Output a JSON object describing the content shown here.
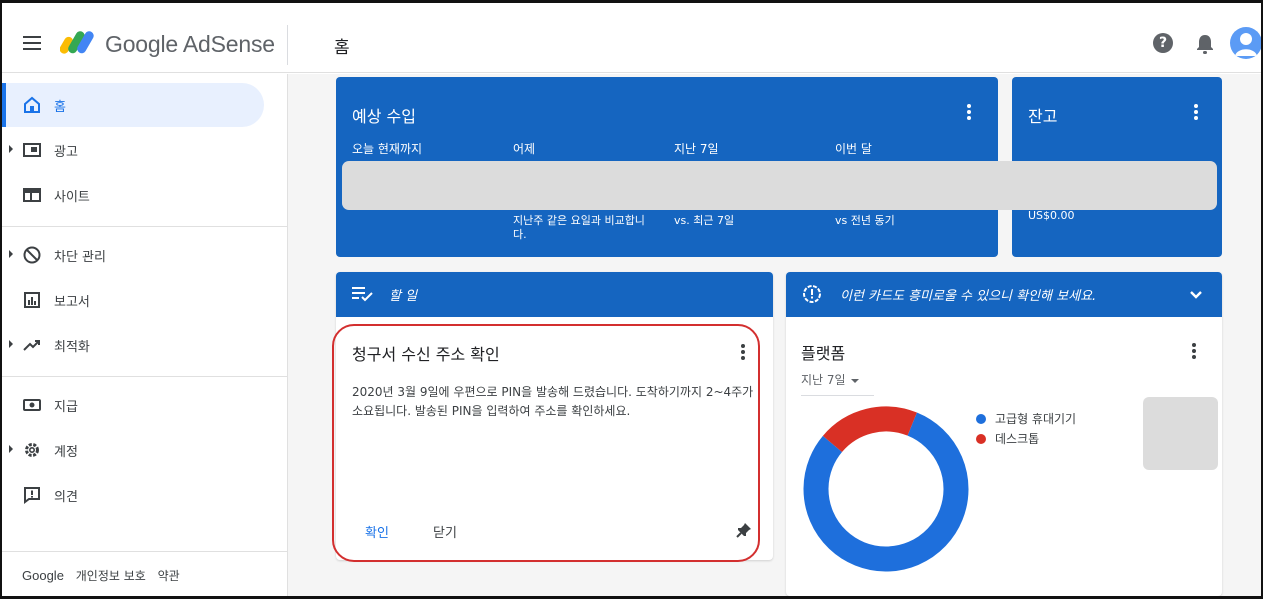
{
  "header": {
    "app_name": "Google AdSense",
    "page_title": "홈",
    "help_glyph": "?"
  },
  "sidebar": {
    "items": [
      {
        "label": "홈",
        "icon": "home-icon",
        "active": true
      },
      {
        "label": "광고",
        "icon": "ads-icon",
        "expandable": true
      },
      {
        "label": "사이트",
        "icon": "sites-icon"
      },
      {
        "label": "차단 관리",
        "icon": "block-icon",
        "expandable": true
      },
      {
        "label": "보고서",
        "icon": "reports-icon"
      },
      {
        "label": "최적화",
        "icon": "optimization-icon",
        "expandable": true
      },
      {
        "label": "지급",
        "icon": "payments-icon"
      },
      {
        "label": "계정",
        "icon": "gear-icon",
        "expandable": true
      },
      {
        "label": "의견",
        "icon": "feedback-icon"
      }
    ],
    "footer": {
      "brand": "Google",
      "privacy": "개인정보 보호",
      "terms": "약관"
    }
  },
  "earnings_card": {
    "title": "예상 수입",
    "columns": [
      "오늘 현재까지",
      "어제",
      "지난 7일",
      "이번 달"
    ],
    "sub": [
      "",
      "지난주 같은 요일과 비교합니다.",
      "vs. 최근 7일",
      "vs 전년 동기"
    ]
  },
  "balance_card": {
    "title": "잔고",
    "amount": "US$0.00"
  },
  "todo_card": {
    "header": "할 일",
    "title": "청구서 수신 주소 확인",
    "body": "2020년 3월 9일에 우편으로 PIN을 발송해 드렸습니다. 도착하기까지 2~4주가 소요됩니다. 발송된 PIN을 입력하여 주소를 확인하세요.",
    "confirm": "확인",
    "dismiss": "닫기"
  },
  "platform_card": {
    "header": "이런 카드도 흥미로울 수 있으니 확인해 보세요.",
    "title": "플랫폼",
    "period": "지난 7일",
    "legend": [
      {
        "label": "고급형 휴대기기",
        "color": "#1e6fdc",
        "share": 0.8
      },
      {
        "label": "데스크톱",
        "color": "#d93025",
        "share": 0.2
      }
    ]
  },
  "colors": {
    "brand_blue": "#1565c0",
    "accent": "#1a73e8"
  }
}
